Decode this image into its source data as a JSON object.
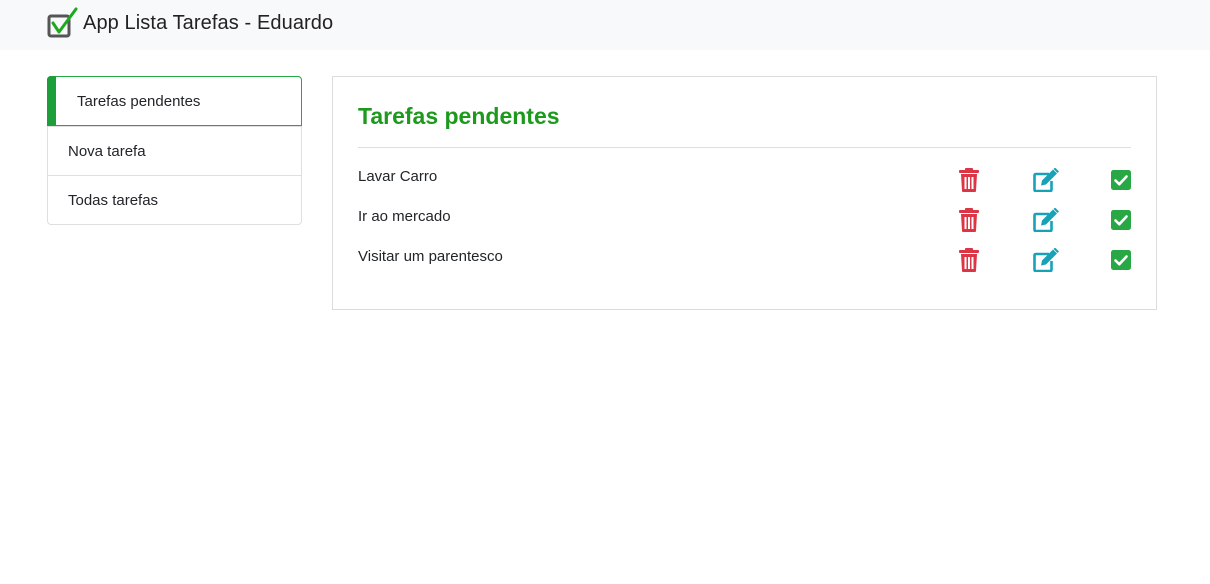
{
  "header": {
    "title": "App Lista Tarefas - Eduardo",
    "logo_icon": "checkbox-check-logo-icon"
  },
  "sidebar": {
    "items": [
      {
        "label": "Tarefas pendentes",
        "active": true
      },
      {
        "label": "Nova tarefa",
        "active": false
      },
      {
        "label": "Todas tarefas",
        "active": false
      }
    ]
  },
  "main": {
    "title": "Tarefas pendentes",
    "tasks": [
      {
        "text": "Lavar Carro"
      },
      {
        "text": "Ir ao mercado"
      },
      {
        "text": "Visitar um parentesco"
      }
    ],
    "icons": {
      "delete": "trash-icon",
      "edit": "edit-icon",
      "complete": "check-square-icon"
    }
  },
  "colors": {
    "accent_green": "#1d9a1d",
    "delete_red": "#dc3545",
    "edit_teal": "#17a2b8",
    "check_green": "#28a745",
    "navbar_bg": "#f8f9fa"
  }
}
